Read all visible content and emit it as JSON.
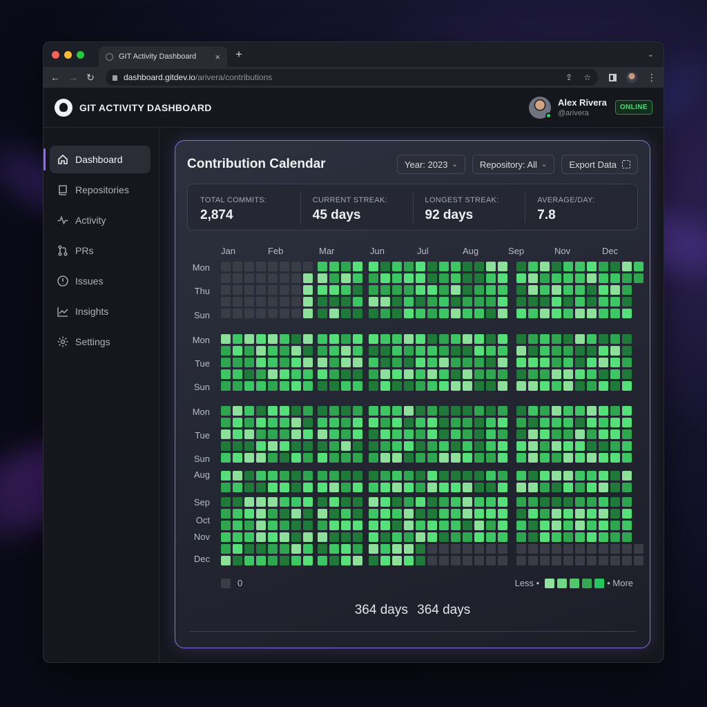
{
  "browser": {
    "tab_title": "GIT Activity Dashboard",
    "tab_close": "×",
    "new_tab": "+",
    "url_host": "dashboard.gitdev.io",
    "url_path": "/arivera/contributions"
  },
  "app": {
    "title": "GIT ACTIVITY DASHBOARD",
    "user_name": "Alex Rivera",
    "user_handle": "@arivera",
    "status": "ONLINE"
  },
  "sidebar": {
    "items": [
      {
        "label": "Dashboard",
        "icon": "home-icon",
        "active": true
      },
      {
        "label": "Repositories",
        "icon": "repo-icon",
        "active": false
      },
      {
        "label": "Activity",
        "icon": "activity-icon",
        "active": false
      },
      {
        "label": "PRs",
        "icon": "pull-request-icon",
        "active": false
      },
      {
        "label": "Issues",
        "icon": "issue-icon",
        "active": false
      },
      {
        "label": "Insights",
        "icon": "insights-icon",
        "active": false
      },
      {
        "label": "Settings",
        "icon": "gear-icon",
        "active": false
      }
    ]
  },
  "card": {
    "title": "Contribution Calendar",
    "year_filter": "Year: 2023",
    "repo_filter": "Repository: All",
    "export_label": "Export Data",
    "stats": [
      {
        "label": "TOTAL COMMITS:",
        "value": "2,874"
      },
      {
        "label": "CURRENT STREAK:",
        "value": "45 days"
      },
      {
        "label": "LONGEST STREAK:",
        "value": "92 days"
      },
      {
        "label": "AVERAGE/DAY:",
        "value": "7.8"
      }
    ],
    "months": [
      "Jan",
      "Feb",
      "Mar",
      "Jun",
      "Jul",
      "Aug",
      "Sep",
      "Nov",
      "Dec"
    ],
    "day_labels": [
      "Mon",
      "Thu",
      "Sun",
      "Mon",
      "Tue",
      "Sun",
      "Mon",
      "Tue",
      "Sun",
      "Aug",
      "Sep",
      "Oct",
      "Nov",
      "Dec"
    ],
    "legend_zero": "0",
    "legend_less": "Less •",
    "legend_more": "• More",
    "footer_a": "364 days",
    "footer_b": "364 days"
  },
  "colors": {
    "accent": "#8d6cf0",
    "online": "#3ddc74",
    "empty": "#3a3d46",
    "levels": [
      "#3a3d46",
      "#1f7a3a",
      "#2ea64f",
      "#3cc764",
      "#55e07a",
      "#8ce09a"
    ],
    "legend_levels": [
      "#8ee39c",
      "#6fd884",
      "#4fc96a",
      "#34a853",
      "#22c55e"
    ]
  }
}
